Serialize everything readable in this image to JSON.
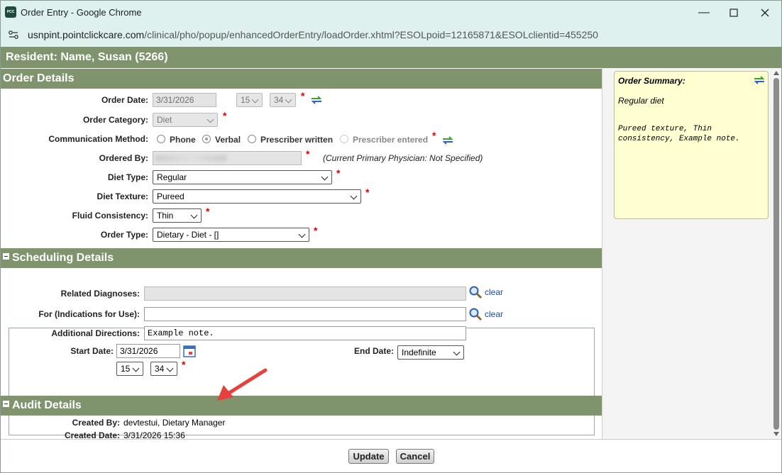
{
  "window": {
    "app_icon_text": "PCC",
    "title": "Order Entry - Google Chrome",
    "url_host": "usnpint.pointclickcare.com",
    "url_path": "/clinical/pho/popup/enhancedOrderEntry/loadOrder.xhtml?ESOLpoid=12165871&ESOLclientid=455250"
  },
  "resident": {
    "title": "Resident: Name, Susan (5266)"
  },
  "order_details": {
    "header": "Order Details",
    "order_date_label": "Order Date:",
    "order_date_value": "3/31/2026",
    "hour_value": "15",
    "minute_value": "34",
    "order_category_label": "Order Category:",
    "order_category_value": "Diet",
    "communication_label": "Communication Method:",
    "comm_options": [
      "Phone",
      "Verbal",
      "Prescriber written",
      "Prescriber entered"
    ],
    "ordered_by_label": "Ordered By:",
    "ordered_by_note": "(Current Primary Physician: Not Specified)",
    "diet_type_label": "Diet Type:",
    "diet_type_value": "Regular",
    "diet_texture_label": "Diet Texture:",
    "diet_texture_value": "Pureed",
    "fluid_label": "Fluid Consistency:",
    "fluid_value": "Thin",
    "order_type_label": "Order Type:",
    "order_type_value": "Dietary - Diet - []",
    "required_mark": "*"
  },
  "scheduling": {
    "header": "Scheduling Details",
    "related_dx_label": "Related Diagnoses:",
    "indications_label": "For (Indications for Use):",
    "clear_label": "clear",
    "additional_label": "Additional Directions:",
    "additional_value": "Example note.",
    "start_date_label": "Start Date:",
    "start_date_value": "3/31/2026",
    "start_hour": "15",
    "start_minute": "34",
    "end_date_label": "End Date:",
    "end_date_value": "Indefinite"
  },
  "audit": {
    "header": "Audit Details",
    "created_by_label": "Created By:",
    "created_by_value": "devtestui, Dietary Manager",
    "created_date_label": "Created Date:",
    "created_date_value": "3/31/2026 15:36"
  },
  "summary": {
    "title": "Order Summary:",
    "line1": "Regular diet",
    "line2": "Pureed texture, Thin consistency, Example note."
  },
  "footer": {
    "update_label": "Update",
    "cancel_label": "Cancel"
  },
  "colors": {
    "header_green": "#7f946d",
    "summary_yellow": "#ffffd2",
    "chrome_bg": "#dff1ee",
    "required_red": "#d00000",
    "annotation_arrow": "#e8403c"
  }
}
